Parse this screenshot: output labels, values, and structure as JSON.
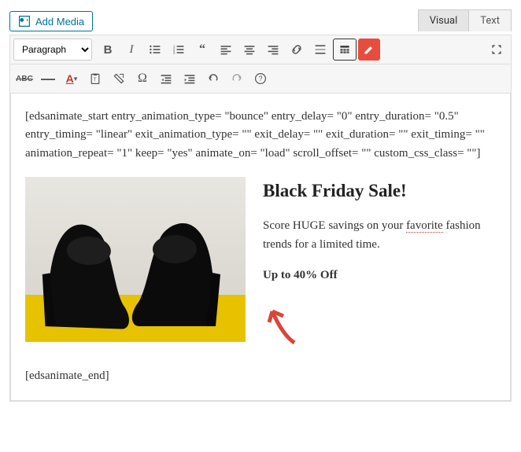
{
  "top": {
    "add_media_label": "Add Media",
    "tabs": {
      "visual": "Visual",
      "text": "Text"
    }
  },
  "toolbar": {
    "format_selected": "Paragraph"
  },
  "content": {
    "shortcode_open": "[edsanimate_start entry_animation_type= \"bounce\" entry_delay= \"0\" entry_duration= \"0.5\" entry_timing= \"linear\" exit_animation_type= \"\" exit_delay= \"\" exit_duration= \"\" exit_timing= \"\" animation_repeat= \"1\" keep= \"yes\" animate_on= \"load\" scroll_offset= \"\" custom_css_class= \"\"]",
    "heading": "Black Friday Sale!",
    "body_pre": "Score HUGE savings on your ",
    "body_underlined": "favorite",
    "body_post": " fashion trends for a limited time.",
    "discount": "Up to 40% Off",
    "shortcode_close": "[edsanimate_end]"
  },
  "icons": {
    "media": "media-icon",
    "bold": "B",
    "italic": "I",
    "fullscreen": "X"
  }
}
